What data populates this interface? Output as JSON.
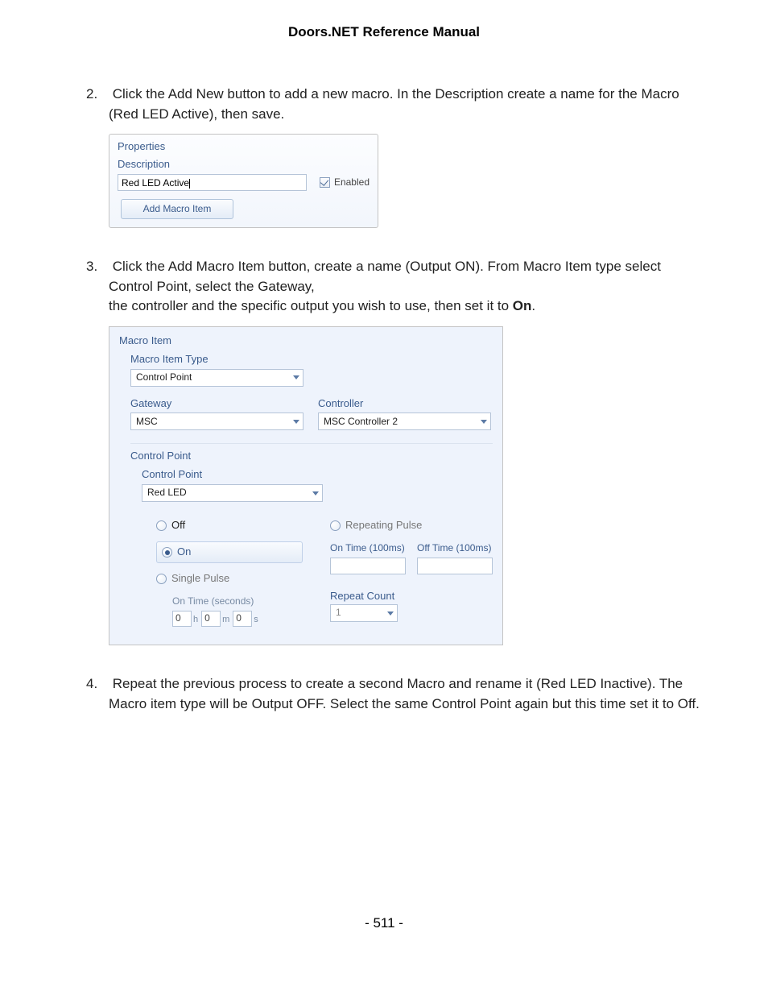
{
  "page_title": "Doors.NET Reference Manual",
  "page_number": "- 511 -",
  "steps": {
    "step2_num": "2.",
    "step2_text": "Click the Add New button to add a new macro. In the Description create a name for the Macro (Red LED Active), then save.",
    "step3_num": "3.",
    "step3_text_a": "Click the Add Macro Item button, create a name (Output ON). From Macro Item type select Control Point, select the Gateway,",
    "step3_text_b": "the controller and the specific output you wish to use, then set it to ",
    "step3_text_bold": "On",
    "step3_text_c": ".",
    "step4_num": "4.",
    "step4_text": "Repeat the previous process to create a second Macro and rename it (Red LED Inactive). The Macro item type will be Output OFF. Select the same Control Point again but this time set it to Off."
  },
  "shot1": {
    "header": "Properties",
    "desc_label": "Description",
    "desc_value": "Red LED Active",
    "enabled_label": "Enabled",
    "add_button": "Add Macro Item"
  },
  "shot2": {
    "header": "Macro Item",
    "type_label": "Macro Item Type",
    "type_value": "Control Point",
    "gateway_label": "Gateway",
    "gateway_value": "MSC",
    "controller_label": "Controller",
    "controller_value": "MSC Controller 2",
    "cp_group_title": "Control Point",
    "cp_label": "Control Point",
    "cp_value": "Red LED",
    "opt_off": "Off",
    "opt_on": "On",
    "opt_single": "Single Pulse",
    "ontime_sec_label": "On Time (seconds)",
    "hms_h": "0",
    "hms_h_u": "h",
    "hms_m": "0",
    "hms_m_u": "m",
    "hms_s": "0",
    "hms_s_u": "s",
    "opt_repeating": "Repeating Pulse",
    "ontime_label": "On Time (100ms)",
    "offtime_label": "Off Time (100ms)",
    "repeat_label": "Repeat Count",
    "repeat_value": "1"
  }
}
